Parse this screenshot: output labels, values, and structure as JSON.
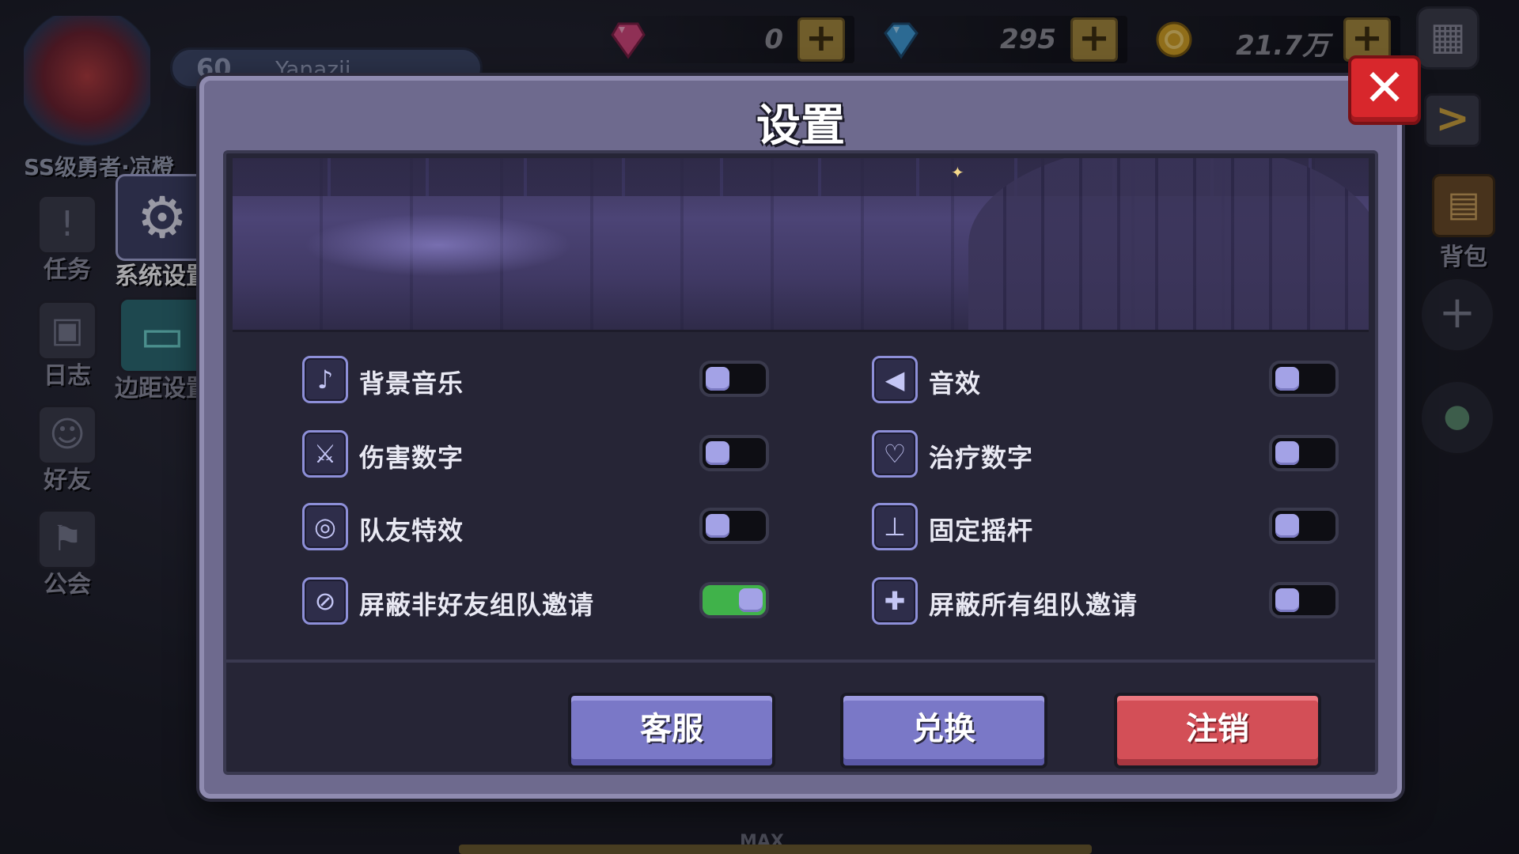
{
  "hud": {
    "player_level": "60",
    "player_name": "Yanazii",
    "player_title": "SS级勇者·凉橙",
    "currencies": [
      {
        "icon": "pink-gem-icon",
        "amount": "0",
        "color": "#d8457a"
      },
      {
        "icon": "blue-gem-icon",
        "amount": "295",
        "color": "#3f9fd9"
      },
      {
        "icon": "gold-coin-icon",
        "amount": "21.7万",
        "color": "#d9a520"
      }
    ],
    "plus_glyph": "+",
    "menu_glyph": "▦",
    "next_glyph": ">",
    "max_label": "MAX"
  },
  "left_nav": {
    "items": [
      {
        "label": "任务",
        "icon": "exclamation-icon",
        "glyph": "!"
      },
      {
        "label": "系统设置",
        "icon": "gear-icon",
        "glyph": "⚙"
      },
      {
        "label": "日志",
        "icon": "journal-icon",
        "glyph": "▣"
      },
      {
        "label": "边距设置",
        "icon": "gamepad-icon",
        "glyph": "▭"
      },
      {
        "label": "好友",
        "icon": "friend-icon",
        "glyph": "☺"
      },
      {
        "label": "公会",
        "icon": "guild-banner-icon",
        "glyph": "⚑"
      }
    ]
  },
  "right_nav": {
    "bag_label": "背包",
    "bag_glyph": "▤",
    "add_glyph": "+",
    "chat_glyph": "●"
  },
  "modal": {
    "title": "设置",
    "close_glyph": "✕",
    "settings": [
      {
        "label": "背景音乐",
        "icon": "music-note-icon",
        "glyph": "♪",
        "enabled": false
      },
      {
        "label": "音效",
        "icon": "speaker-icon",
        "glyph": "◀",
        "enabled": false
      },
      {
        "label": "伤害数字",
        "icon": "sword-icon",
        "glyph": "⚔",
        "enabled": false
      },
      {
        "label": "治疗数字",
        "icon": "heart-icon",
        "glyph": "♡",
        "enabled": false
      },
      {
        "label": "队友特效",
        "icon": "sparkle-icon",
        "glyph": "◎",
        "enabled": false
      },
      {
        "label": "固定摇杆",
        "icon": "joystick-icon",
        "glyph": "⊥",
        "enabled": false
      },
      {
        "label": "屏蔽非好友组队邀请",
        "icon": "block-stranger-icon",
        "glyph": "⊘",
        "enabled": true
      },
      {
        "label": "屏蔽所有组队邀请",
        "icon": "block-all-icon",
        "glyph": "✚",
        "enabled": false
      }
    ],
    "buttons": {
      "support": "客服",
      "redeem": "兑换",
      "logout": "注销"
    },
    "colors": {
      "toggle_on": "#40b24a",
      "button_purple": "#7a78c7",
      "button_red": "#d34f57",
      "close_red": "#d8272c"
    }
  }
}
